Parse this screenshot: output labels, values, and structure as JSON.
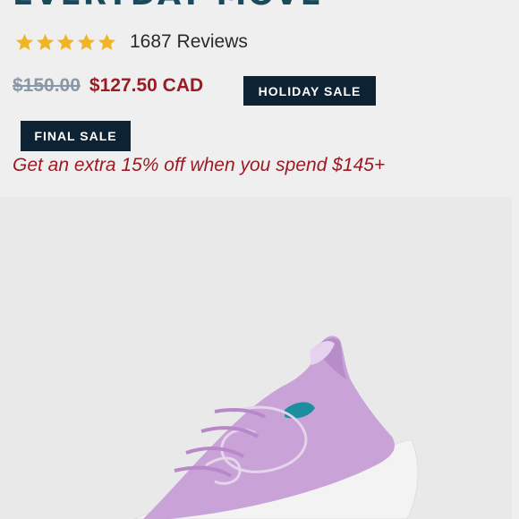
{
  "product": {
    "title": "EVERYDAY MOVE",
    "rating_stars": 5,
    "reviews_label": "1687 Reviews"
  },
  "price": {
    "original": "$150.00",
    "sale": "$127.50 CAD"
  },
  "badges": {
    "holiday": "HOLIDAY SALE",
    "final": "FINAL SALE"
  },
  "promo": {
    "text": "Get an extra 15% off when you spend $145+"
  },
  "colors": {
    "title": "#1b4a5a",
    "star": "#f0b429",
    "sale_red": "#9b1b24",
    "badge_bg": "#0d2233",
    "shoe_lilac": "#c9a3d8",
    "sole": "#f2f2f2"
  },
  "icons": {
    "star": "star-icon"
  }
}
